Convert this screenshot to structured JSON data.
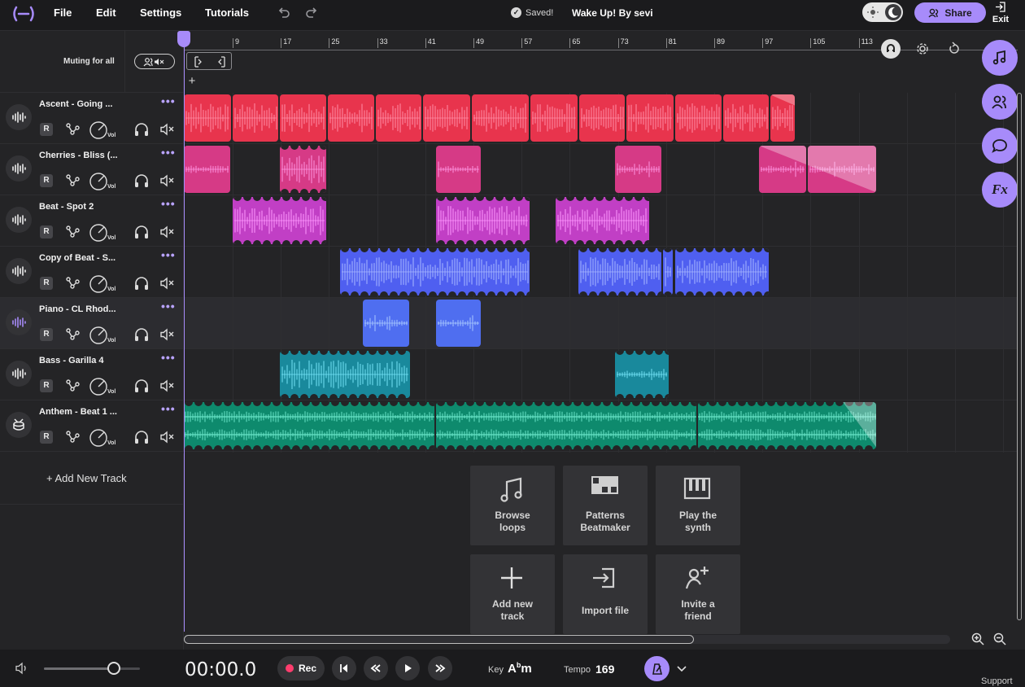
{
  "menu": {
    "file": "File",
    "edit": "Edit",
    "settings": "Settings",
    "tutorials": "Tutorials"
  },
  "status": {
    "saved": "Saved!"
  },
  "project": {
    "title": "Wake Up! By sevi"
  },
  "header": {
    "share": "Share",
    "exit": "Exit"
  },
  "tracks_header": {
    "muting_label": "Muting for all"
  },
  "ruler": {
    "bars": [
      "9",
      "17",
      "25",
      "33",
      "41",
      "49",
      "57",
      "65",
      "73",
      "81",
      "89",
      "97",
      "105",
      "113"
    ]
  },
  "tracks": [
    {
      "name": "Ascent - Going ...",
      "r": "R",
      "vol": "Vol",
      "color": "#e8344d",
      "icon": "waveform-icon"
    },
    {
      "name": "Cherries - Bliss (...",
      "r": "R",
      "vol": "Vol",
      "color": "#d63a86",
      "icon": "waveform-icon"
    },
    {
      "name": "Beat - Spot 2",
      "r": "R",
      "vol": "Vol",
      "color": "#c13fc5",
      "icon": "waveform-icon"
    },
    {
      "name": "Copy of Beat - S...",
      "r": "R",
      "vol": "Vol",
      "color": "#4f5ff0",
      "icon": "waveform-icon"
    },
    {
      "name": "Piano - CL Rhod...",
      "r": "R",
      "vol": "Vol",
      "color": "#4f6ef0",
      "icon": "waveform-icon"
    },
    {
      "name": "Bass - Garilla 4",
      "r": "R",
      "vol": "Vol",
      "color": "#19899c",
      "icon": "waveform-icon"
    },
    {
      "name": "Anthem - Beat 1 ...",
      "r": "R",
      "vol": "Vol",
      "color": "#0e8a6d",
      "icon": "drum-icon"
    }
  ],
  "add_track": "+ Add New Track",
  "quick_actions": [
    {
      "line1": "Browse",
      "line2": "loops",
      "icon": "music-note-icon"
    },
    {
      "line1": "Patterns",
      "line2": "Beatmaker",
      "icon": "grid-pattern-icon"
    },
    {
      "line1": "Play the",
      "line2": "synth",
      "icon": "piano-keys-icon"
    },
    {
      "line1": "Add new",
      "line2": "track",
      "icon": "plus-icon"
    },
    {
      "line1": "Import file",
      "line2": "",
      "icon": "import-icon"
    },
    {
      "line1": "Invite a",
      "line2": "friend",
      "icon": "add-user-icon"
    }
  ],
  "side_panel": [
    "music-note-icon",
    "collaborators-icon",
    "chat-icon",
    "fx-icon"
  ],
  "fx_label": "Fx",
  "transport": {
    "time": "00:00.0",
    "rec": "Rec",
    "key_label": "Key",
    "key_note": "A",
    "key_accidental": "b",
    "key_mode": "m",
    "tempo_label": "Tempo",
    "tempo_value": "169",
    "volume_level": 0.73
  },
  "support": "Support",
  "colors": {
    "accent": "#a78bfa",
    "background": "#242426",
    "bar": "#1b1b1d"
  }
}
